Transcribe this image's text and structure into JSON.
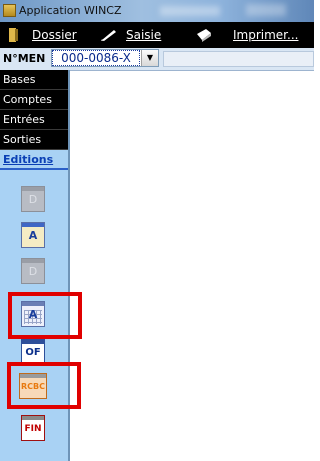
{
  "window": {
    "title": "Application WINCZ"
  },
  "menubar": {
    "items": [
      {
        "label": "Dossier",
        "icon": "folder-icon"
      },
      {
        "label": "Saisie",
        "icon": "pen-icon"
      },
      {
        "label": "Imprimer...",
        "icon": "printer-icon"
      }
    ]
  },
  "toolbar": {
    "n_label": "N°MEN",
    "selected_value": "000-0086-X"
  },
  "sidebar": {
    "nav": [
      {
        "label": "Bases"
      },
      {
        "label": "Comptes"
      },
      {
        "label": "Entrées"
      },
      {
        "label": "Sorties"
      },
      {
        "label": "Editions"
      }
    ],
    "tools": [
      {
        "icon": "report-d-icon",
        "label": "D",
        "enabled": false
      },
      {
        "icon": "report-a-icon",
        "label": "A",
        "enabled": true
      },
      {
        "icon": "report-d2-icon",
        "label": "D",
        "enabled": false
      },
      {
        "icon": "report-a-grid-icon",
        "label": "A",
        "enabled": true,
        "highlighted": true
      },
      {
        "icon": "report-of-icon",
        "label": "OF",
        "enabled": true
      },
      {
        "icon": "report-rcbc-icon",
        "label": "RCBC",
        "enabled": true,
        "highlighted": true
      },
      {
        "icon": "report-fin-icon",
        "label": "FIN",
        "enabled": true
      }
    ]
  },
  "colors": {
    "sidebar_bg": "#a9d2f4",
    "nav_bg": "#000000",
    "highlight_box": "#e00000",
    "active_nav": "#0a3fb5"
  }
}
